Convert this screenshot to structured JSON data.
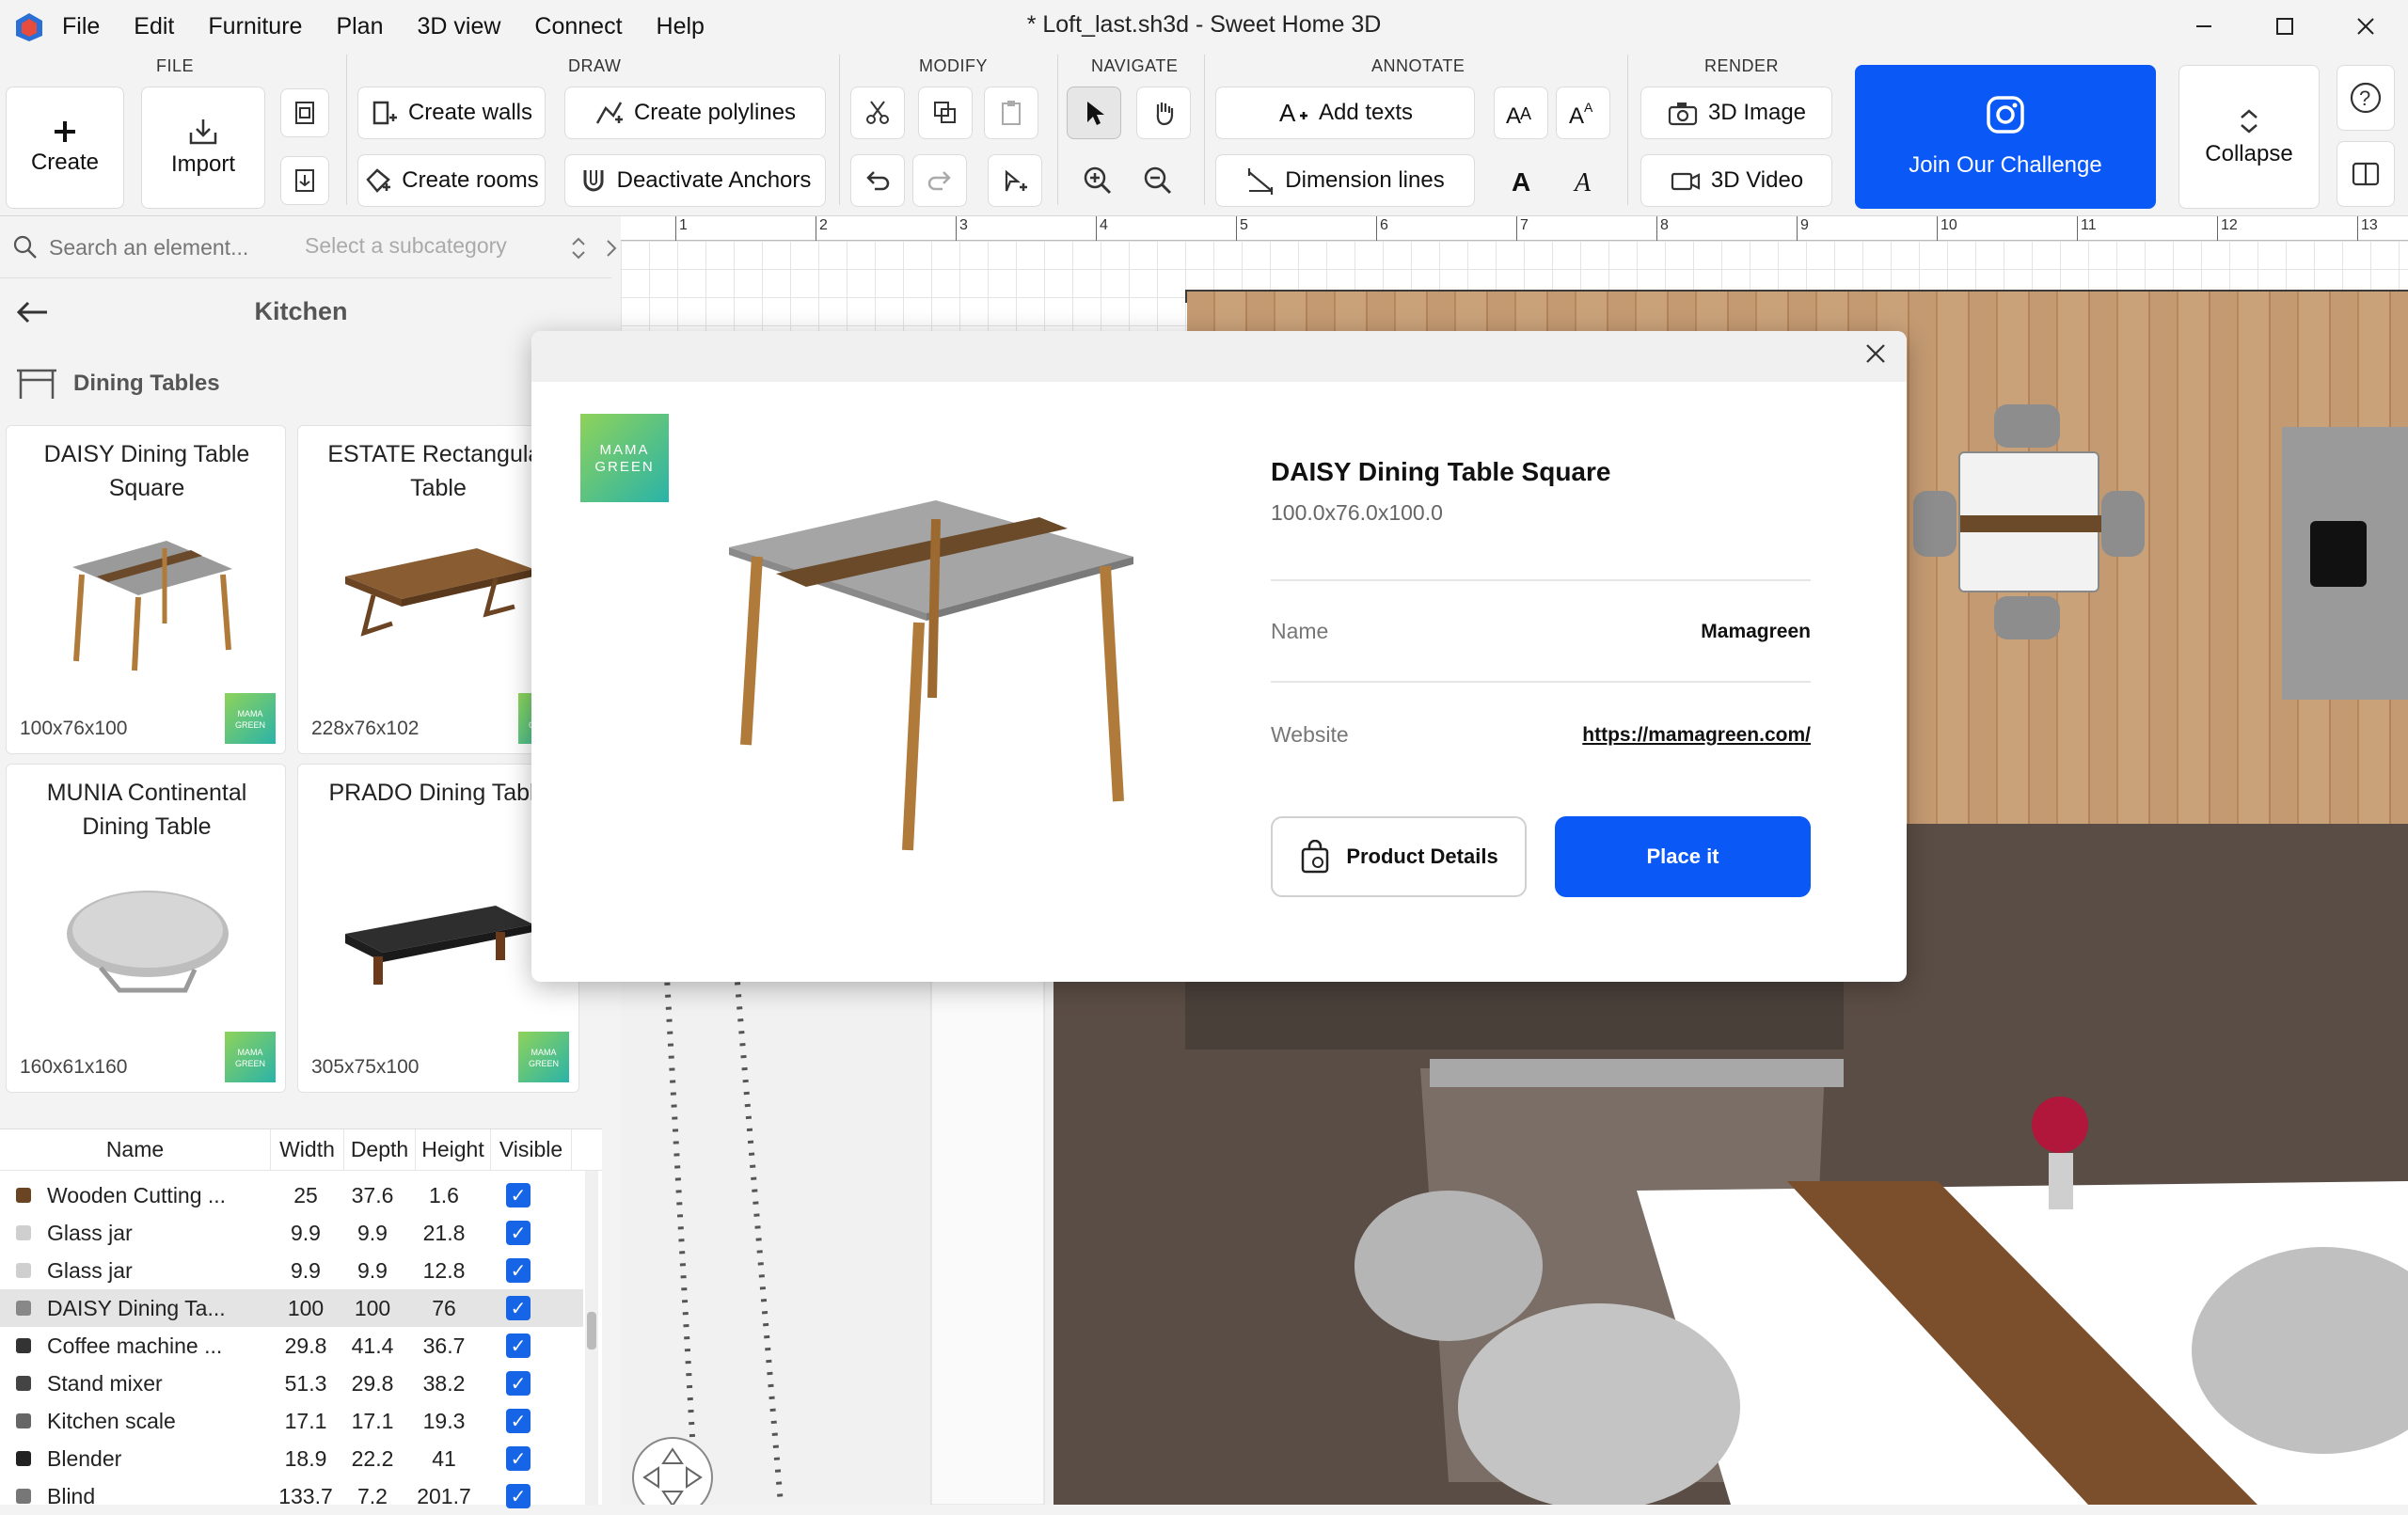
{
  "window": {
    "title": "* Loft_last.sh3d - Sweet Home 3D",
    "menu": [
      "File",
      "Edit",
      "Furniture",
      "Plan",
      "3D view",
      "Connect",
      "Help"
    ]
  },
  "ribbon": {
    "groups": {
      "file": "FILE",
      "draw": "DRAW",
      "modify": "MODIFY",
      "navigate": "NAVIGATE",
      "annotate": "ANNOTATE",
      "render": "RENDER"
    },
    "create": "Create",
    "import": "Import",
    "create_walls": "Create walls",
    "create_polylines": "Create polylines",
    "create_rooms": "Create rooms",
    "deactivate_anchors": "Deactivate Anchors",
    "add_texts": "Add texts",
    "dimension_lines": "Dimension lines",
    "image_3d": "3D Image",
    "video_3d": "3D Video",
    "challenge": "Join Our Challenge",
    "collapse": "Collapse"
  },
  "catalog": {
    "search_placeholder": "Search an element...",
    "subcategory_placeholder": "Select a subcategory",
    "category": "Kitchen",
    "subcategory": "Dining Tables",
    "brand_badge": "MAMA GREEN",
    "items": [
      {
        "name": "DAISY Dining Table Square",
        "dims": "100x76x100"
      },
      {
        "name": "ESTATE Rectangular Table",
        "dims": "228x76x102"
      },
      {
        "name": "MUNIA Continental Dining Table",
        "dims": "160x61x160"
      },
      {
        "name": "PRADO Dining Table",
        "dims": "305x75x100"
      }
    ]
  },
  "furniture_table": {
    "columns": [
      "Name",
      "Width",
      "Depth",
      "Height",
      "Visible"
    ],
    "rows": [
      {
        "name": "Wooden Cutting ...",
        "width": "25",
        "depth": "37.6",
        "height": "1.6"
      },
      {
        "name": "Glass jar",
        "width": "9.9",
        "depth": "9.9",
        "height": "21.8"
      },
      {
        "name": "Glass jar",
        "width": "9.9",
        "depth": "9.9",
        "height": "12.8"
      },
      {
        "name": "DAISY Dining Ta...",
        "width": "100",
        "depth": "100",
        "height": "76"
      },
      {
        "name": "Coffee machine ...",
        "width": "29.8",
        "depth": "41.4",
        "height": "36.7"
      },
      {
        "name": "Stand mixer",
        "width": "51.3",
        "depth": "29.8",
        "height": "38.2"
      },
      {
        "name": "Kitchen scale",
        "width": "17.1",
        "depth": "17.1",
        "height": "19.3"
      },
      {
        "name": "Blender",
        "width": "18.9",
        "depth": "22.2",
        "height": "41"
      },
      {
        "name": "Blind",
        "width": "133.7",
        "depth": "7.2",
        "height": "201.7"
      }
    ]
  },
  "ruler": [
    "1",
    "2",
    "3",
    "4",
    "5",
    "6",
    "7",
    "8",
    "9",
    "10",
    "11",
    "12",
    "13"
  ],
  "modal": {
    "brand_logo": "MAMA GREEN",
    "title": "DAISY Dining Table Square",
    "dims": "100.0x76.0x100.0",
    "name_label": "Name",
    "name_value": "Mamagreen",
    "website_label": "Website",
    "website_value": "https://mamagreen.com/",
    "details_button": "Product Details",
    "place_button": "Place it"
  },
  "colors": {
    "accent": "#0a58f5",
    "brand_gradient_start": "#8ed35a",
    "brand_gradient_end": "#2ab3a8"
  }
}
